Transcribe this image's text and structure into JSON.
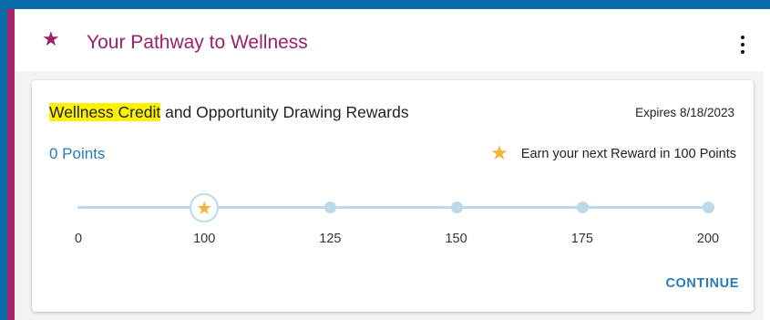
{
  "header": {
    "icon": "star-icon",
    "title": "Your Pathway to Wellness",
    "menu_icon": "kebab-menu-icon"
  },
  "card": {
    "title_highlight": "Wellness Credit",
    "title_rest": " and Opportunity Drawing Rewards",
    "expires": "Expires 8/18/2023",
    "points": "0 Points",
    "next_reward": "Earn your next Reward in 100 Points",
    "continue_label": "CONTINUE",
    "progress": {
      "current_value": 0,
      "current_milestone": 100,
      "milestones": [
        "0",
        "100",
        "125",
        "150",
        "175",
        "200"
      ]
    }
  },
  "colors": {
    "frame_blue": "#0b6aa8",
    "accent_magenta": "#a5266b",
    "link_blue": "#2a7ab9",
    "star_gold": "#f4b43c",
    "highlight_yellow": "#fff200",
    "track_light_blue": "#bcd9ea"
  }
}
